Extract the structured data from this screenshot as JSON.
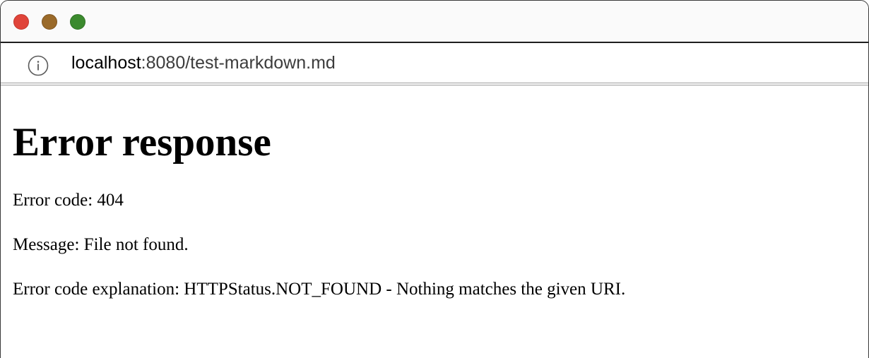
{
  "window": {
    "traffic_lights": {
      "close": "#e0443a",
      "minimize": "#9a6a2a",
      "zoom": "#3b8a2e"
    }
  },
  "address_bar": {
    "icon": "info-icon",
    "host": "localhost",
    "path": ":8080/test-markdown.md"
  },
  "page": {
    "heading": "Error response",
    "error_code": "Error code: 404",
    "message": "Message: File not found.",
    "explanation": "Error code explanation: HTTPStatus.NOT_FOUND - Nothing matches the given URI."
  }
}
